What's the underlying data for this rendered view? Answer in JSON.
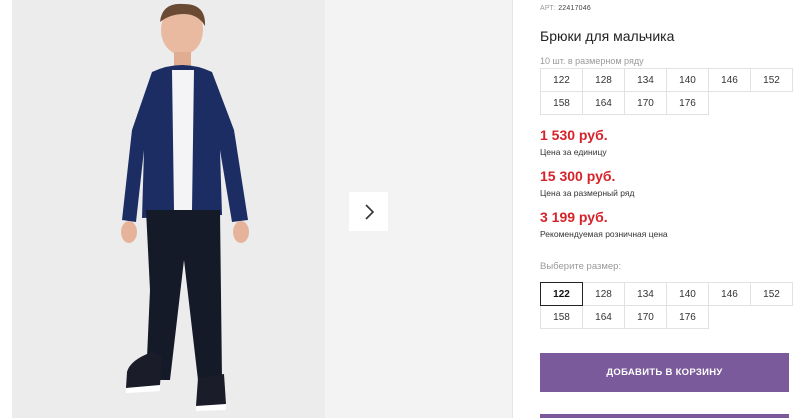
{
  "product": {
    "art_label": "АРТ:",
    "art_number": "22417046",
    "title": "Брюки для мальчика",
    "range_note": "10 шт. в размерном ряду"
  },
  "size_range": [
    "122",
    "128",
    "134",
    "140",
    "146",
    "152",
    "158",
    "164",
    "170",
    "176"
  ],
  "prices": [
    {
      "value": "1 530 руб.",
      "label": "Цена за единицу"
    },
    {
      "value": "15 300 руб.",
      "label": "Цена за размерный ряд"
    },
    {
      "value": "3 199 руб.",
      "label": "Рекомендуемая розничная цена"
    }
  ],
  "size_select": {
    "label": "Выберите размер:",
    "options": [
      "122",
      "128",
      "134",
      "140",
      "146",
      "152",
      "158",
      "164",
      "170",
      "176"
    ],
    "selected": "122"
  },
  "cart": {
    "label": "ДОБАВИТЬ В КОРЗИНУ"
  },
  "gallery": {
    "next_icon": "chevron-right-icon"
  },
  "colors": {
    "accent": "#7a5a9a",
    "price": "#d6232a",
    "shirt": "#1c2d63",
    "pants": "#151a28"
  }
}
